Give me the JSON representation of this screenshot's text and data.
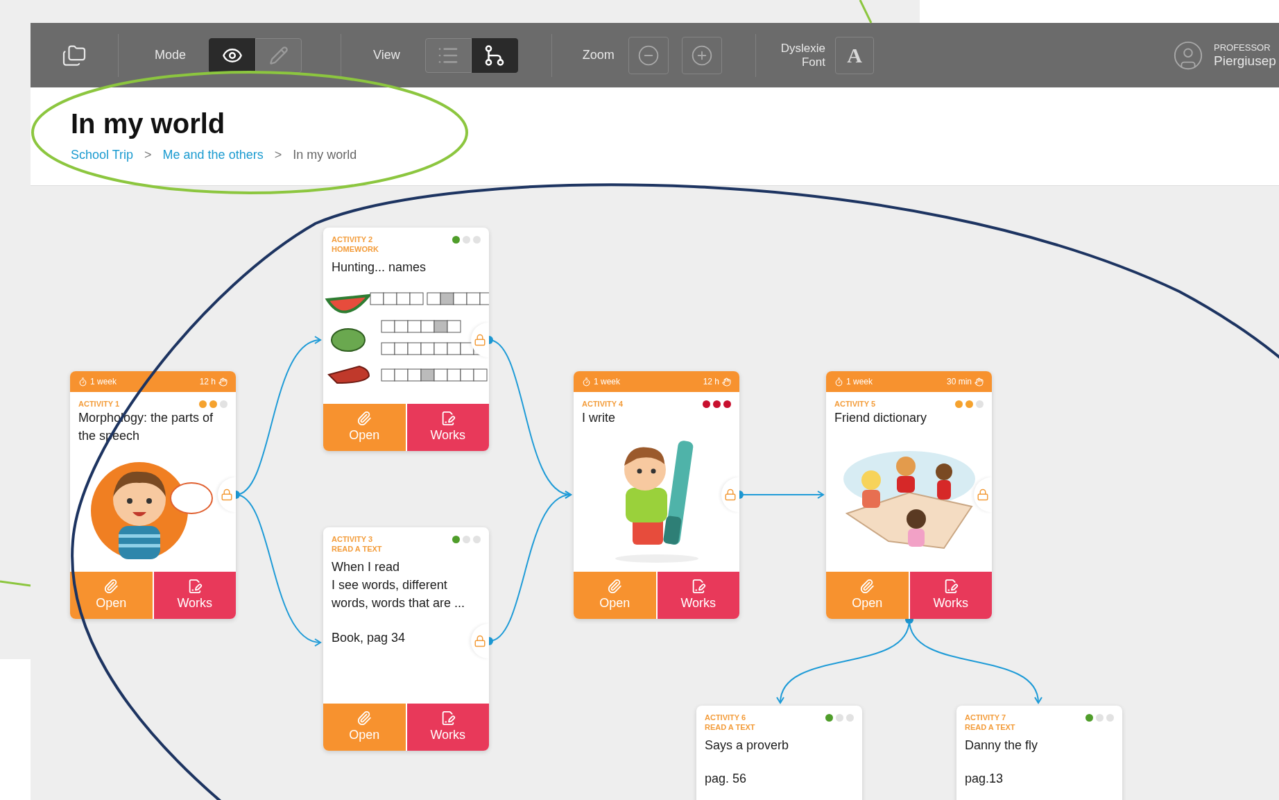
{
  "toolbar": {
    "mode_label": "Mode",
    "mode_buttons": [
      {
        "kind": "view",
        "selected": true
      },
      {
        "kind": "edit",
        "selected": false
      }
    ],
    "view_label": "View",
    "view_buttons": [
      {
        "kind": "list",
        "selected": false
      },
      {
        "kind": "tree",
        "selected": true
      }
    ],
    "zoom_label": "Zoom",
    "dyslexie_label": "Dyslexie\nFont",
    "font_button": "A",
    "user": {
      "role": "PROFESSOR",
      "name": "Piergiusep"
    }
  },
  "header": {
    "title": "In my world",
    "breadcrumb": [
      {
        "label": "School Trip",
        "link": true
      },
      {
        "label": "Me and the others",
        "link": true,
        "separator": ">"
      },
      {
        "label": "In my world",
        "link": false,
        "separator": ">"
      }
    ]
  },
  "activities": [
    {
      "duration": "1 week",
      "effort": "12 h",
      "label": "ACTIVITY 1",
      "dots": [
        {
          "color": "#f5a22e"
        },
        {
          "color": "#f5a22e"
        },
        {
          "color": "#e2e2e2"
        }
      ],
      "title": "Morphology: the parts of the speech",
      "kind": "boy-speaking",
      "buttons": [
        "Open",
        "Works"
      ],
      "locked": true
    },
    {
      "label": "ACTIVITY 2",
      "type": "HOMEWORK",
      "dots": [
        {
          "color": "#4f9d2a"
        },
        {
          "color": "#e2e2e2"
        },
        {
          "color": "#e2e2e2"
        }
      ],
      "title": "Hunting... names",
      "kind": "worksheet",
      "buttons": [
        "Open",
        "Works"
      ],
      "locked": true
    },
    {
      "label": "ACTIVITY 3",
      "type": "READ A TEXT",
      "dots": [
        {
          "color": "#4f9d2a"
        },
        {
          "color": "#e2e2e2"
        },
        {
          "color": "#e2e2e2"
        }
      ],
      "title": "When I read\nI see words, different words, words that are ...",
      "note": "Book, pag 34",
      "buttons": [
        "Open",
        "Works"
      ],
      "locked": true
    },
    {
      "duration": "1 week",
      "effort": "12 h",
      "label": "ACTIVITY 4",
      "dots": [
        {
          "color": "#c8102e"
        },
        {
          "color": "#c8102e"
        },
        {
          "color": "#c8102e"
        }
      ],
      "title": "I write",
      "kind": "boy-pen",
      "buttons": [
        "Open",
        "Works"
      ],
      "locked": true
    },
    {
      "duration": "1 week",
      "effort": "30 min",
      "label": "ACTIVITY 5",
      "dots": [
        {
          "color": "#f5a22e"
        },
        {
          "color": "#f5a22e"
        },
        {
          "color": "#e2e2e2"
        }
      ],
      "title": "Friend dictionary",
      "kind": "kids-book",
      "buttons": [
        "Open",
        "Works"
      ],
      "locked": true
    },
    {
      "label": "ACTIVITY 6",
      "type": "READ A TEXT",
      "dots": [
        {
          "color": "#4f9d2a"
        },
        {
          "color": "#e2e2e2"
        },
        {
          "color": "#e2e2e2"
        }
      ],
      "title": "Says a proverb",
      "note": "pag. 56"
    },
    {
      "label": "ACTIVITY 7",
      "type": "READ A TEXT",
      "dots": [
        {
          "color": "#4f9d2a"
        },
        {
          "color": "#e2e2e2"
        },
        {
          "color": "#e2e2e2"
        }
      ],
      "title": "Danny the fly",
      "note": "pag.13"
    }
  ]
}
